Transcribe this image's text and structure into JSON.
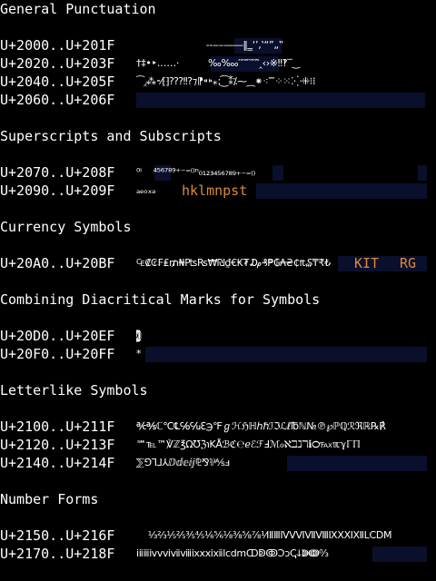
{
  "sections": [
    {
      "title": "General Punctuation",
      "rows": [
        {
          "range": "U+2000..U+201F",
          "glyphs": "                        ‐‑‒–—―‖‗‘’‚‛“”„‟"
        },
        {
          "range": "U+2020..U+203F",
          "glyphs": "†‡•‣․‥…‧          ‰‱′″‴‵‶‷‸‹›※‼‽‾‿"
        },
        {
          "range": "U+2040..U+205F",
          "glyphs": "⁀⁁⁂⁃⁄⁅⁆⁇⁈⁉⁊⁋⁌⁍⁎⁏⁐⁑⁒⁓⁔⁕⁖⁗⁘⁙⁚⁛⁜⁝⁞ "
        },
        {
          "range": "U+2060..U+206F",
          "glyphs": ""
        }
      ]
    },
    {
      "title": "Superscripts and Subscripts",
      "rows": [
        {
          "range": "U+2070..U+208F",
          "glyphs": "⁰ⁱ    ⁴⁵⁶⁷⁸⁹⁺⁻⁼⁽⁾ⁿ₀₁₂₃₄₅₆₇₈₉₊₋₌₍₎"
        },
        {
          "range": "U+2090..U+209F",
          "glyphs": "ₐₑₒₓₔ",
          "latin": "hklmnpst"
        }
      ]
    },
    {
      "title": "Currency Symbols",
      "rows": [
        {
          "range": "U+20A0..U+20BF",
          "glyphs": "₠₡₢₣₤₥₦₧₨₩₪₫€₭₮₯₰₱₲₳₴₵₶₷₸₹₺",
          "latin1": "KIT",
          "latin2": "RG"
        }
      ]
    },
    {
      "title": "Combining Diacritical Marks for Symbols",
      "rows": [
        {
          "range": "U+20D0..U+20EF",
          "glyphs": "⃒⃓⃘⃙⃚⃐⃑⃔⃕⃖⃗⃛⃜⃝⃞⃟⃠⃡⃢⃣⃤⃥⃦⃪⃫⃨⃬⃭⃮⃯⃧⃩"
        },
        {
          "range": "U+20F0..U+20FF",
          "glyphs": "*"
        }
      ]
    },
    {
      "title": "Letterlike Symbols",
      "rows": [
        {
          "range": "U+2100..U+211F",
          "glyphs": "℀℁ℂ℃℄℅℆ℇ℈℉ℊℋℌℍℎℏℐℑℒℓ℔ℕ№℗℘ℙℚℛℜℝ℞℟"
        },
        {
          "range": "U+2120..U+213F",
          "glyphs": "℠℡™℣ℤ℥Ω℧ℨ℩KÅℬℭ℮ℯℰℱℲℳℴℵℶℷℸℹ℺℻ℼℽℾℿ"
        },
        {
          "range": "U+2140..U+214F",
          "glyphs": "⅀⅁⅂⅃⅄ⅅⅆⅇⅈⅉ⅊⅋⅌⅍ⅎ"
        }
      ]
    },
    {
      "title": "Number Forms",
      "rows": [
        {
          "range": "U+2150..U+216F",
          "glyphs": "    ⅓⅔⅕⅖⅗⅘⅙⅚⅛⅜⅝⅞⅟ⅠⅡⅢⅣⅤⅥⅦⅧⅨⅩⅪⅫⅬⅭⅮⅯ"
        },
        {
          "range": "U+2170..U+218F",
          "glyphs": "ⅰⅱⅲⅳⅴⅵⅶⅷⅸⅹⅺⅻⅼⅽⅾⅿↀↁↂↃↄↅↆↇↈ↉"
        }
      ]
    }
  ],
  "colors": {
    "background": "#000000",
    "text": "#ffffff",
    "unassigned": "#0a0f2c",
    "latin_fallback": "#d98a3a"
  }
}
